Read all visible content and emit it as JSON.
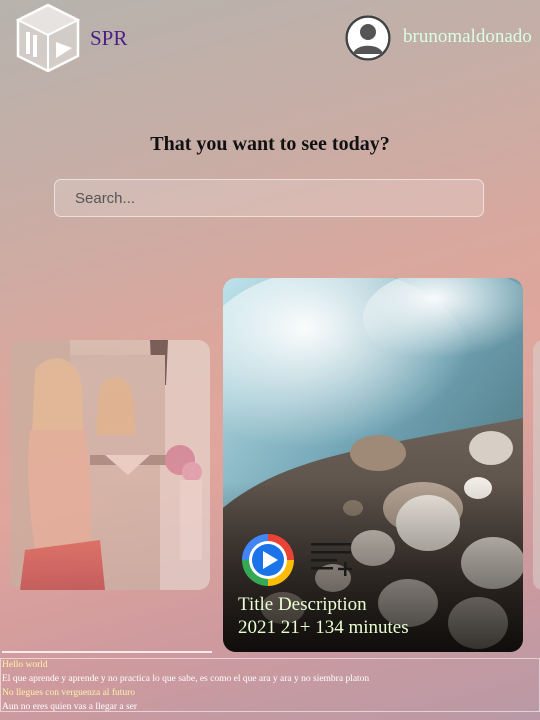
{
  "header": {
    "brand": "SPR",
    "username": "brunomaldonado"
  },
  "main": {
    "question": "That you want to see today?",
    "search_placeholder": "Search..."
  },
  "featured": {
    "title": "Title Description",
    "meta": "2021 21+ 134 minutes"
  },
  "footer": {
    "lines": [
      "Hello world",
      "El que aprende y aprende y no practica lo que sabe, es como el que ara y ara y no siembra platon",
      "No llegues con verguenza al futuro",
      "Aun no eres quien vas a llegar a ser"
    ]
  },
  "colors": {
    "brand": "#4b1f86",
    "username": "#d9ffe6",
    "card_text": "#e9ffd2",
    "footer_yellow": "#fff3a8"
  },
  "icons": [
    "logo-cube-icon",
    "user-avatar-icon",
    "play-circle-icon",
    "add-to-queue-icon"
  ]
}
